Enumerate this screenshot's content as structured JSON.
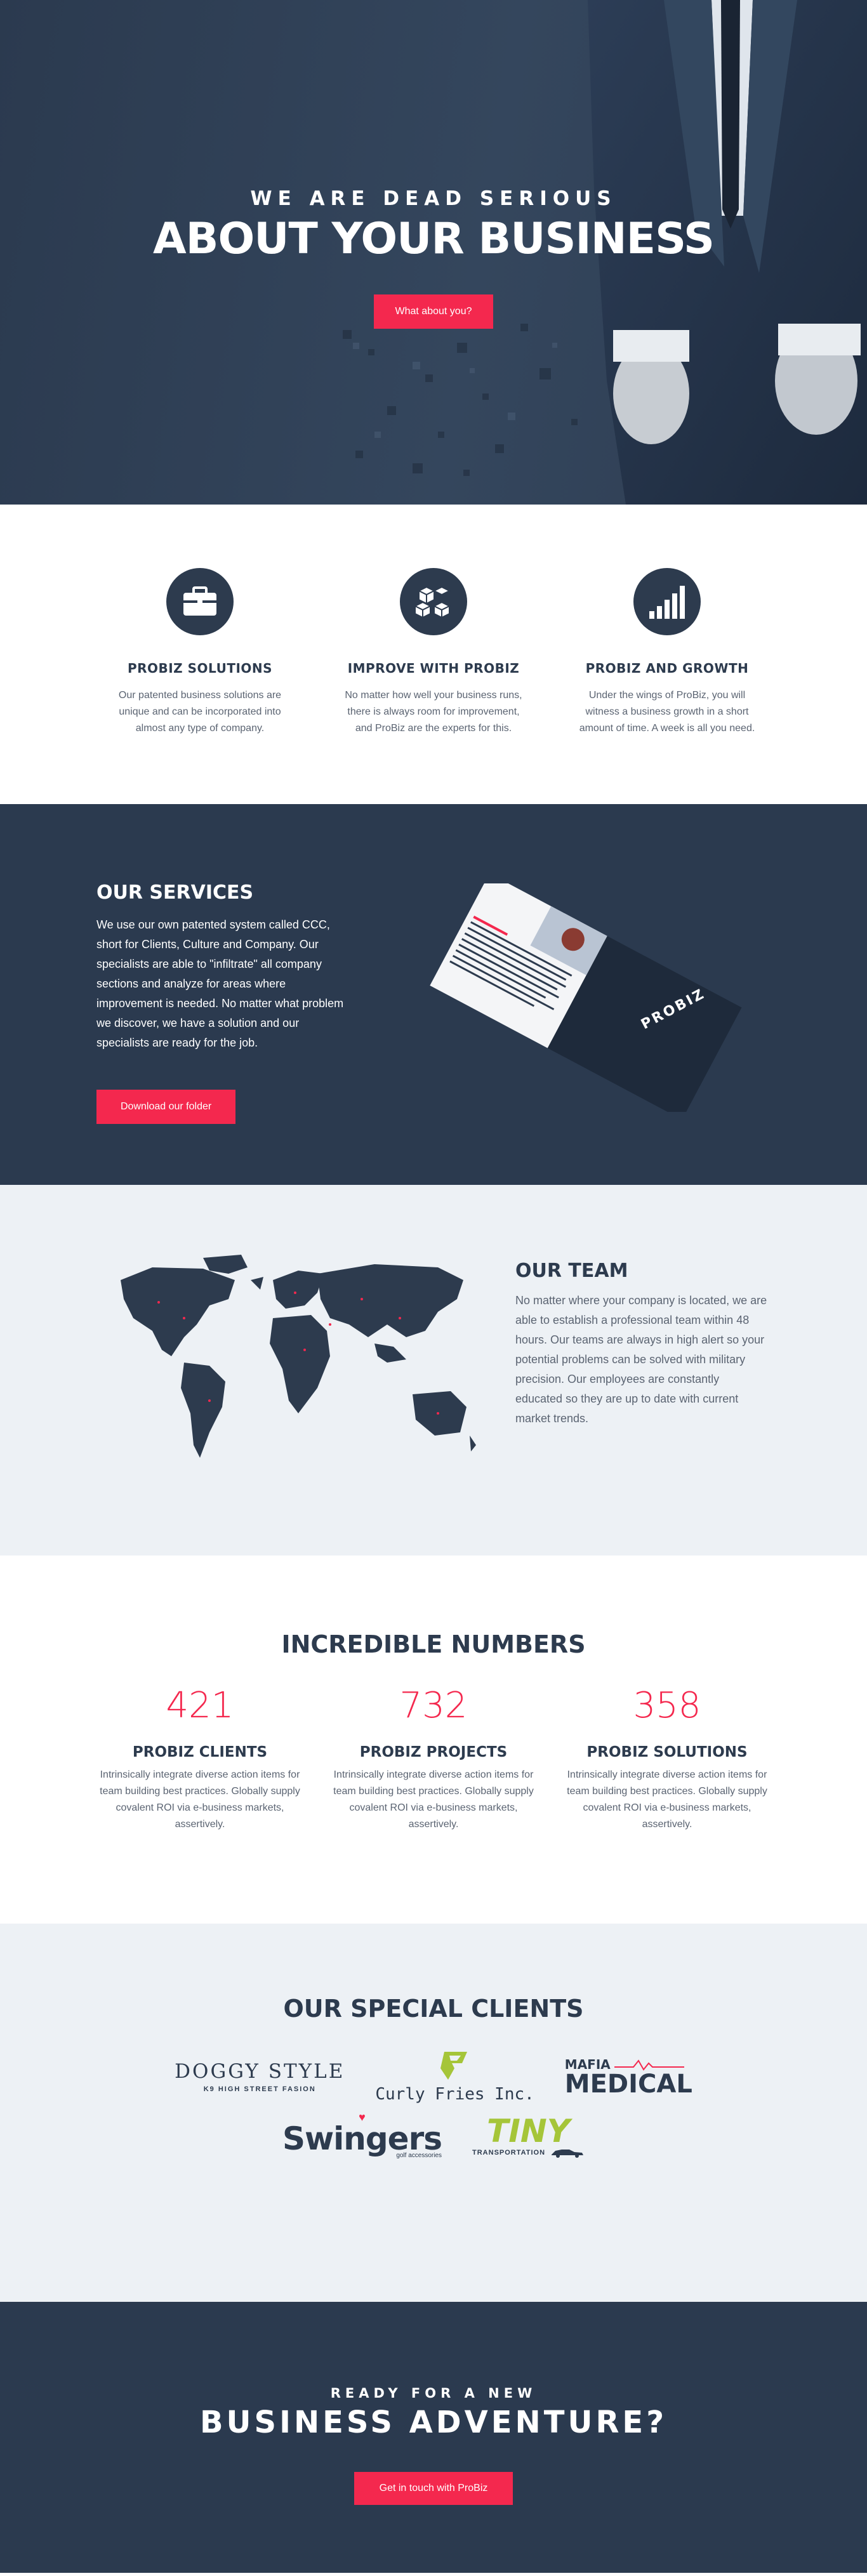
{
  "hero": {
    "subtitle": "WE ARE DEAD SERIOUS",
    "title": "ABOUT YOUR BUSINESS",
    "button": "What about you?"
  },
  "features": [
    {
      "icon": "briefcase-icon",
      "title": "PROBIZ SOLUTIONS",
      "text": "Our patented business solutions are unique and can be incorporated into almost any type of company."
    },
    {
      "icon": "cubes-icon",
      "title": "IMPROVE WITH PROBIZ",
      "text": "No matter how well your business runs, there is always room for improvement, and ProBiz are the experts for this."
    },
    {
      "icon": "bar-chart-icon",
      "title": "PROBIZ AND GROWTH",
      "text": "Under the wings of ProBiz, you will witness a business growth in a short amount of time. A week is all you need."
    }
  ],
  "services": {
    "title": "OUR SERVICES",
    "text": "We use our own patented system called CCC, short for Clients, Culture and Company. Our specialists are able to \"infiltrate\" all company sections and analyze for areas where improvement is needed. No matter what problem we discover, we have a solution and our specialists are ready for the job.",
    "button": "Download our folder",
    "folder_brand": "PROBIZ"
  },
  "team": {
    "title": "OUR TEAM",
    "text": "No matter where your company is located, we are able to establish a professional team within 48 hours. Our teams are always in high alert so your potential problems can be solved with military precision. Our employees are constantly educated so they are up to date with current market trends."
  },
  "numbers": {
    "title": "INCREDIBLE NUMBERS",
    "items": [
      {
        "value": "421",
        "title": "PROBIZ CLIENTS",
        "text": "Intrinsically integrate diverse action items for team building best practices. Globally supply covalent ROI via e-business markets, assertively."
      },
      {
        "value": "732",
        "title": "PROBIZ PROJECTS",
        "text": "Intrinsically integrate diverse action items for team building best practices. Globally supply covalent ROI via e-business markets, assertively."
      },
      {
        "value": "358",
        "title": "PROBIZ SOLUTIONS",
        "text": "Intrinsically integrate diverse action items for team building best practices. Globally supply covalent ROI via e-business markets, assertively."
      }
    ]
  },
  "clients": {
    "title": "OUR SPECIAL CLIENTS",
    "logos": {
      "doggy": {
        "line1": "DOGGY STYLE",
        "line2": "K9 HIGH STREET FASION"
      },
      "curly": {
        "line1": "Curly Fries Inc."
      },
      "mafia": {
        "line1": "MAFIA",
        "line2": "MEDICAL"
      },
      "swingers": {
        "line1": "Swingers",
        "line2": "golf accessories"
      },
      "tiny": {
        "line1": "TINY",
        "line2": "TRANSPORTATION"
      }
    }
  },
  "cta": {
    "subtitle": "READY FOR A NEW",
    "title": "BUSINESS ADVENTURE?",
    "button": "Get in touch with ProBiz"
  },
  "colors": {
    "navy": "#2b3a4f",
    "accent": "#f4284e",
    "light_bg": "#edf1f5",
    "lime": "#a5c539"
  }
}
